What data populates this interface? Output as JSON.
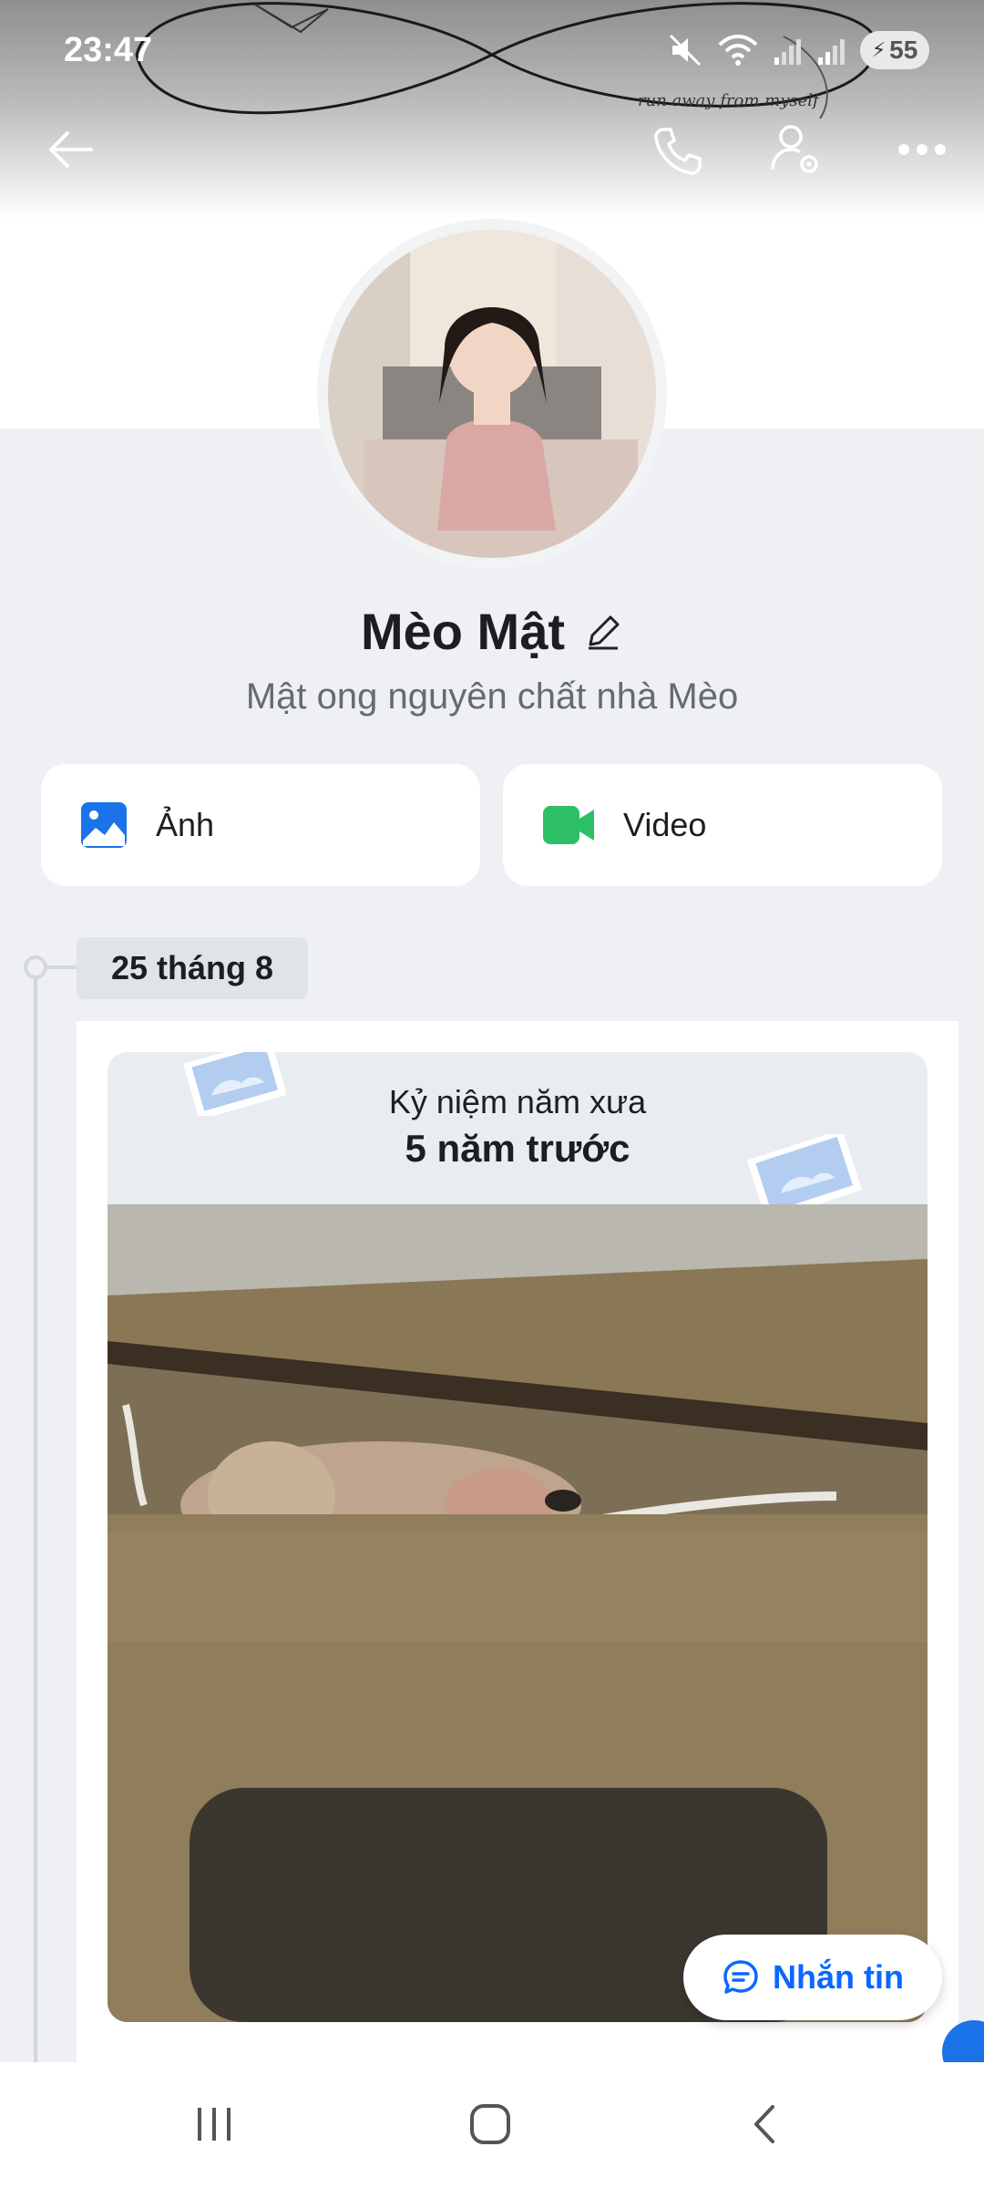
{
  "status_bar": {
    "time": "23:47",
    "battery": "55"
  },
  "cover": {
    "caption": "run away from myself"
  },
  "profile": {
    "name": "Mèo Mật",
    "bio": "Mật ong nguyên chất nhà Mèo"
  },
  "media_buttons": [
    {
      "label": "Ảnh",
      "icon": "image-icon",
      "color": "#1a73e8"
    },
    {
      "label": "Video",
      "icon": "video-icon",
      "color": "#2dbf64"
    }
  ],
  "timeline": {
    "date": "25 tháng 8",
    "memory_title": "Kỷ niệm năm xưa",
    "memory_subtitle": "5 năm trước"
  },
  "message_button": {
    "label": "Nhắn tin",
    "color": "#0a68ff"
  },
  "icons": {
    "back": "back-arrow-icon",
    "call": "phone-icon",
    "profile_settings": "user-settings-icon",
    "more": "more-horizontal-icon"
  }
}
